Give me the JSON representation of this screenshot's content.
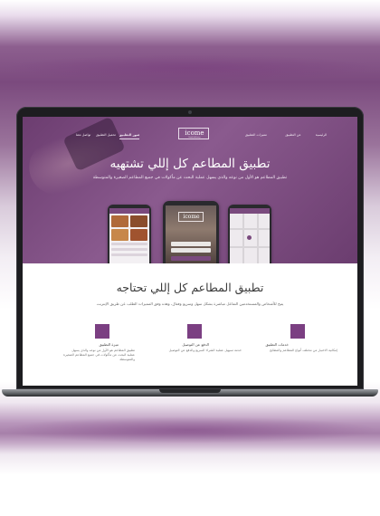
{
  "site": {
    "logo": "icome",
    "logo_tagline": "food delivery",
    "nav": [
      "الرئيسية",
      "عن التطبيق",
      "مميزات التطبيق",
      "صور التطبيق",
      "تحميل التطبيق",
      "تواصل معنا",
      "سجل الدخول"
    ],
    "hero_title": "تطبيق المطاعم كل إللي تشتهيه",
    "hero_subtitle": "تطبيق المطاعم هو الأول من نوعه والذي يسهل عملية البحث عن مأكولات في جميع المطاعم الصغيرة والمتوسطة",
    "app_screen_logo": "icome",
    "section_title": "تطبيق المطاعم كل إللي تحتاجه",
    "section_subtitle": "يتيح للأشخاص والمستخدمين التفاعل مباشرة بشكل سهل وسريع وفعال، وهذه وفق المميزات الطلب عن طريق الإنترنت",
    "features": [
      {
        "title": "خدمات التطبيق",
        "desc": [
          "إمكانية الاختيار من مختلف أنواع المطاعم والمطابخ"
        ]
      },
      {
        "title": "الدفع عن التوصيل",
        "desc": [
          "خدمة تسهيل عملية الشراء السريع والدفع عن التوصيل"
        ]
      },
      {
        "title": "ميزة التطبيق",
        "desc": [
          "تطبيق المطاعم هو الأول من نوعه والذي يسهل",
          "عملية البحث عن مأكولات في جميع المطاعم الصغيرة",
          "والمتوسطة"
        ]
      }
    ]
  },
  "colors": {
    "brand_purple": "#7b3f82",
    "hero_overlay": "#7a4a7e"
  }
}
